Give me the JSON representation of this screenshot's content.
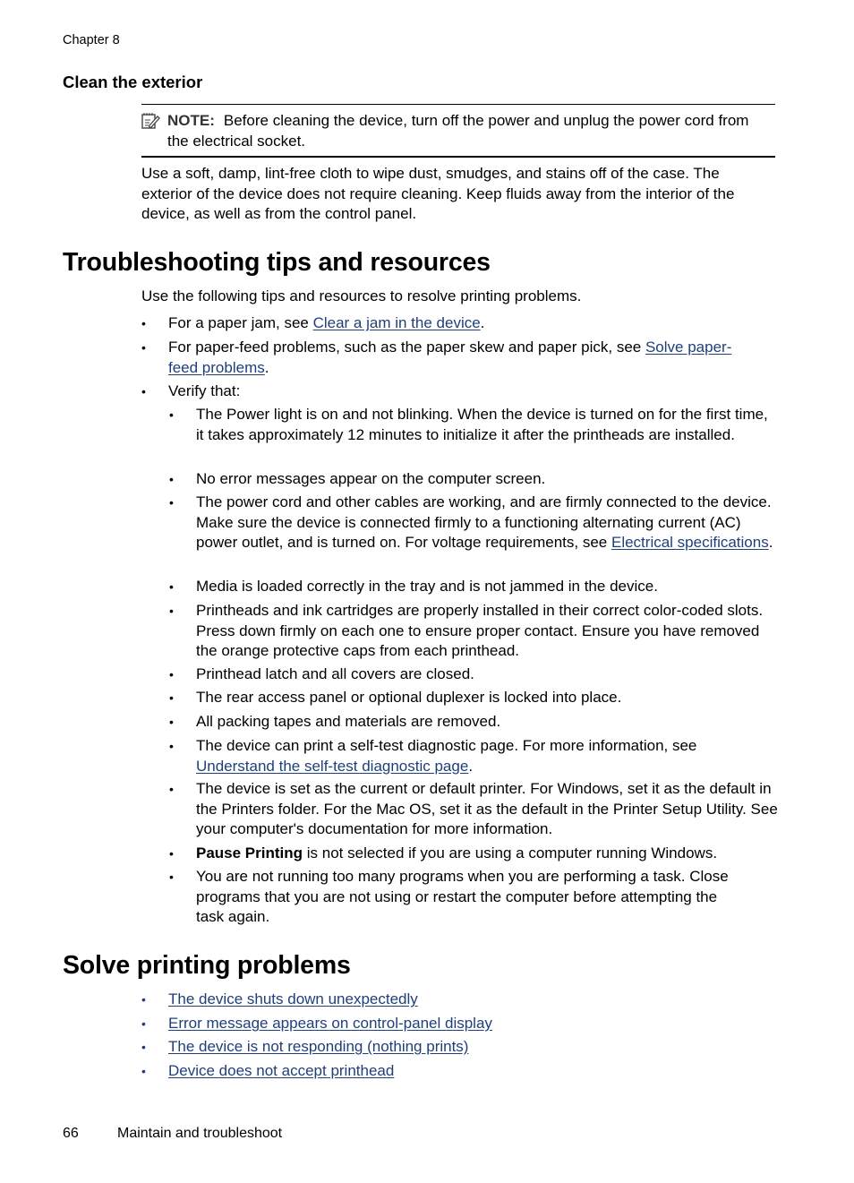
{
  "header": {
    "running_head": "Chapter 8"
  },
  "clean_exterior": {
    "heading": "Clean the exterior",
    "note": {
      "icon": "note-pencil-icon",
      "label": "NOTE:",
      "text": "Before cleaning the device, turn off the power and unplug the power cord from the electrical socket."
    },
    "body": "Use a soft, damp, lint-free cloth to wipe dust, smudges, and stains off of the case. The exterior of the device does not require cleaning. Keep fluids away from the interior of the device, as well as from the control panel."
  },
  "troubleshooting": {
    "heading": "Troubleshooting tips and resources",
    "intro": "Use the following tips and resources to resolve printing problems.",
    "items": [
      {
        "before": "For a paper jam, see ",
        "link": "Clear a jam in the device",
        "after": "."
      },
      {
        "before": "For paper-feed problems, such as the paper skew and paper pick, see ",
        "link": "Solve paper-feed problems",
        "after": "."
      },
      {
        "text": "Verify that:"
      }
    ],
    "verify": [
      {
        "text": "The Power light is on and not blinking. When the device is turned on for the first time, it takes approximately 12 minutes to initialize it after the printheads are installed."
      },
      {
        "text": "No error messages appear on the computer screen."
      },
      {
        "before": "The power cord and other cables are working, and are firmly connected to the device. Make sure the device is connected firmly to a functioning alternating current (AC) power outlet, and is turned on. For voltage requirements, see ",
        "link": "Electrical specifications",
        "after": "."
      },
      {
        "text": "Media is loaded correctly in the tray and is not jammed in the device."
      },
      {
        "text": "Printheads and ink cartridges are properly installed in their correct color-coded slots. Press down firmly on each one to ensure proper contact. Ensure you have removed the orange protective caps from each printhead."
      },
      {
        "text": "Printhead latch and all covers are closed."
      },
      {
        "text": "The rear access panel or optional duplexer is locked into place."
      },
      {
        "text": "All packing tapes and materials are removed."
      },
      {
        "before": "The device can print a self-test diagnostic page. For more information, see ",
        "link": "Understand the self-test diagnostic page",
        "after": "."
      },
      {
        "text": "The device is set as the current or default printer. For Windows, set it as the default in the Printers folder. For the Mac OS, set it as the default in the Printer Setup Utility. See your computer's documentation for more information."
      },
      {
        "bold": "Pause Printing",
        "after": " is not selected if you are using a computer running Windows."
      },
      {
        "text": "You are not running too many programs when you are performing a task. Close programs that you are not using or restart the computer before attempting the task again."
      }
    ],
    "bullet_char": "•"
  },
  "solve_printing": {
    "heading": "Solve printing problems",
    "links": [
      "The device shuts down unexpectedly",
      "Error message appears on control-panel display",
      "The device is not responding (nothing prints)",
      "Device does not accept printhead"
    ]
  },
  "footer": {
    "page_number": "66",
    "section_title": "Maintain and troubleshoot"
  },
  "colors": {
    "link": "#1f3f7a",
    "text": "#000000",
    "note_label": "#333333"
  }
}
